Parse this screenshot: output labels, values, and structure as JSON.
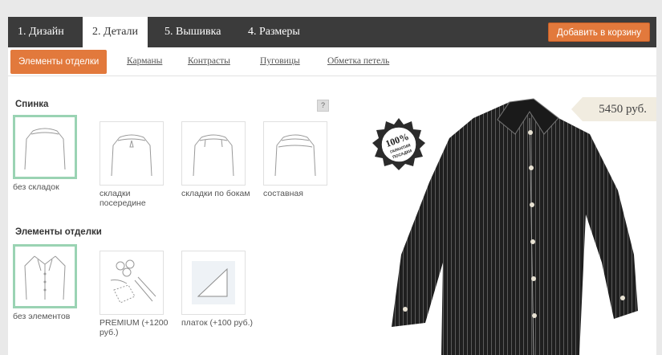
{
  "steps": [
    {
      "label": "1. Дизайн"
    },
    {
      "label": "2. Детали"
    },
    {
      "label": "5. Вышивка"
    },
    {
      "label": "4. Размеры"
    }
  ],
  "cart_button": "Добавить в корзину",
  "subnav": {
    "active": "Элементы отделки",
    "links": [
      "Карманы",
      "Контрасты",
      "Пуговицы",
      "Обметка петель"
    ]
  },
  "back_section": {
    "title": "Спинка",
    "help": "?",
    "options": [
      {
        "label": "без складок",
        "selected": true
      },
      {
        "label": "складки посередине",
        "selected": false
      },
      {
        "label": "складки по бокам",
        "selected": false
      },
      {
        "label": "составная",
        "selected": false
      }
    ]
  },
  "trim_section": {
    "title": "Элементы отделки",
    "options": [
      {
        "label": "без элементов",
        "selected": true
      },
      {
        "label": "PREMIUM (+1200 руб.)",
        "selected": false
      },
      {
        "label": "платок (+100 руб.)",
        "selected": false
      }
    ]
  },
  "price": "5450 руб.",
  "badge": {
    "percent": "100%",
    "line1": "ГАРАНТИЯ",
    "line2": "ПОСАДКИ"
  },
  "colors": {
    "accent": "#e2793c",
    "topbar": "#3b3b3b",
    "selected_border": "#9ad3b3"
  }
}
